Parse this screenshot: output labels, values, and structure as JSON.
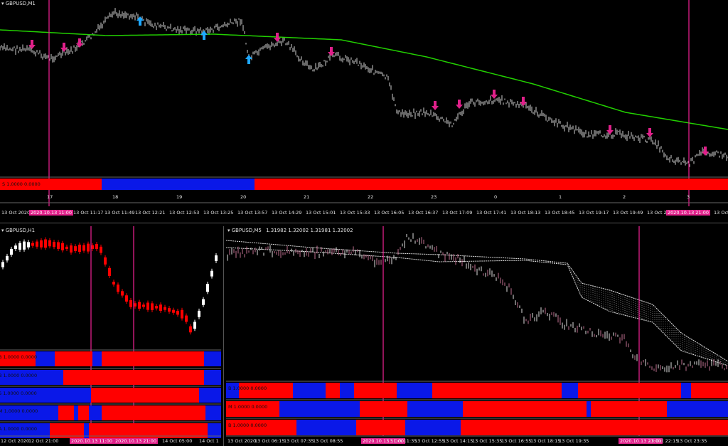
{
  "colors": {
    "bg": "#000000",
    "green": "#22d000",
    "pink": "#e0208a",
    "red": "#ff0000",
    "blue": "#0a18e8",
    "cyan": "#1ea8ff",
    "white": "#ffffff",
    "gray": "#cfcfcf"
  },
  "top": {
    "title": "GBPUSD,M1",
    "strip_label": "S 1.0000 0.0000",
    "hour_labels": [
      "17",
      "18",
      "19",
      "20",
      "21",
      "22",
      "23",
      "0",
      "1",
      "2",
      "3"
    ],
    "time_labels": [
      "13 Oct 2020",
      "2020.10.13 11:00",
      "13 Oct 11:17",
      "13 Oct 11:49",
      "13 Oct 12:21",
      "13 Oct 12:53",
      "13 Oct 13:25",
      "13 Oct 13:57",
      "13 Oct 14:29",
      "13 Oct 15:01",
      "13 Oct 15:33",
      "13 Oct 16:05",
      "13 Oct 16:37",
      "13 Oct 17:09",
      "13 Oct 17:41",
      "13 Oct 18:13",
      "13 Oct 18:45",
      "13 Oct 19:17",
      "13 Oct 19:49",
      "13 Oct 20",
      "2020.10.13 21:00",
      "13 Oct"
    ]
  },
  "left": {
    "title": "GBPUSD,H1",
    "strip_labels": [
      "B 1.0000 0.0000",
      "B 1.0000 0.0000",
      "S 1.0000 0.0000",
      "M 1.0000 0.0000",
      "A 1.0000 0.0000"
    ],
    "time_labels": [
      "12 Oct 2020",
      "12 Oct 21:00",
      "2020.10.13 11:00",
      "2020.10.13 21:00",
      "14 Oct 05:00",
      "14 Oct 1"
    ]
  },
  "right": {
    "title": "GBPUSD,M5",
    "ohlc": "1.31982 1.32002 1.31981 1.32002",
    "strip_labels": [
      "B 1.0000 0.0000",
      "M 1.0000 0.0000",
      "B 1.0000 0.0000"
    ],
    "time_labels": [
      "13 Oct 2020",
      "13 Oct 06:15",
      "13 Oct 07:35",
      "13 Oct 08:55",
      "2020.10.13 11:00",
      "13 Oct 11:35",
      "13 Oct 12:55",
      "13 Oct 14:15",
      "13 Oct 15:35",
      "13 Oct 16:55",
      "13 Oct 18:15",
      "13 Oct 19:35",
      "2020.10.13 21:00",
      "13 Oct 22:15",
      "13 Oct 23:35"
    ]
  }
}
